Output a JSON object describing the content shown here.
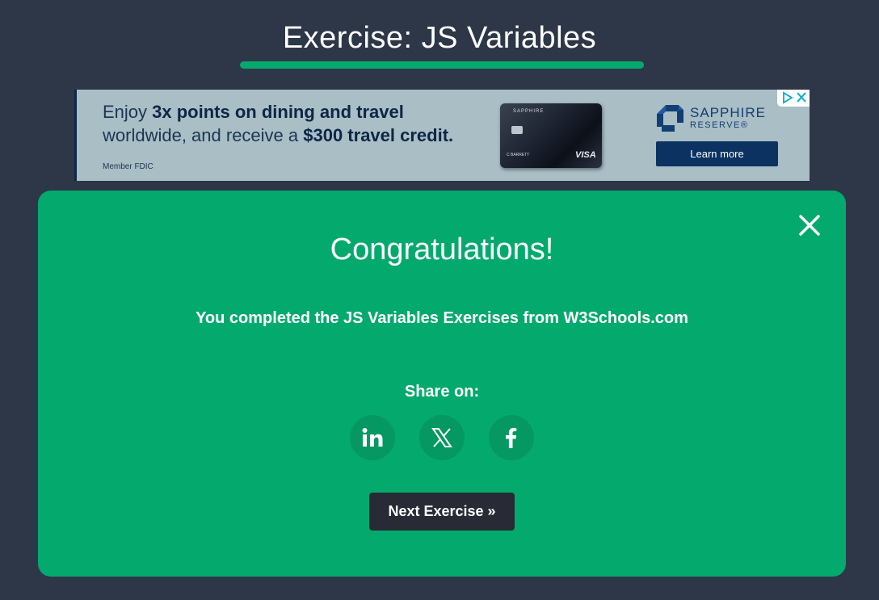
{
  "header": {
    "title": "Exercise: JS Variables"
  },
  "ad": {
    "line1_prefix": "Enjoy ",
    "line1_bold": "3x points on dining and travel",
    "line2_prefix": "worldwide, and receive a ",
    "line2_bold": "$300 travel credit.",
    "disclaimer": "Member FDIC",
    "card_brand": "SAPPHIRE",
    "card_name": "C BARRETT",
    "card_network": "VISA",
    "logo_title": "SAPPHIRE",
    "logo_subtitle": "RESERVE®",
    "cta_label": "Learn more",
    "colors": {
      "background": "#a9bec5",
      "brand_blue": "#123f73",
      "button": "#0b3260"
    }
  },
  "modal": {
    "heading": "Congratulations!",
    "message": "You completed the JS Variables Exercises from W3Schools.com",
    "share_label": "Share on:",
    "share_buttons": [
      {
        "icon": "linkedin-icon"
      },
      {
        "icon": "x-icon"
      },
      {
        "icon": "facebook-icon"
      }
    ],
    "next_label": "Next Exercise »",
    "close_icon": "close-icon"
  },
  "colors": {
    "page_background": "#2d3748",
    "accent_green": "#04aa6d",
    "dark_button": "#282a35"
  }
}
